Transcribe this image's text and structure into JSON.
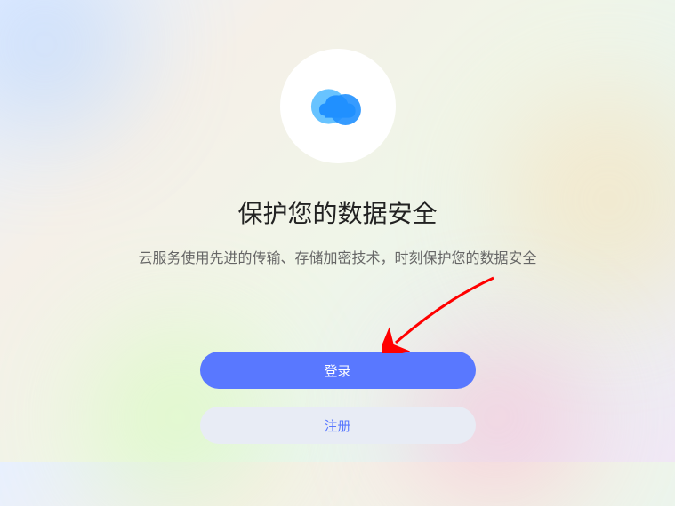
{
  "hero": {
    "title": "保护您的数据安全",
    "subtitle": "云服务使用先进的传输、存储加密技术，时刻保护您的数据安全"
  },
  "buttons": {
    "login": "登录",
    "register": "注册"
  },
  "icon": {
    "name": "cloud-icon"
  }
}
